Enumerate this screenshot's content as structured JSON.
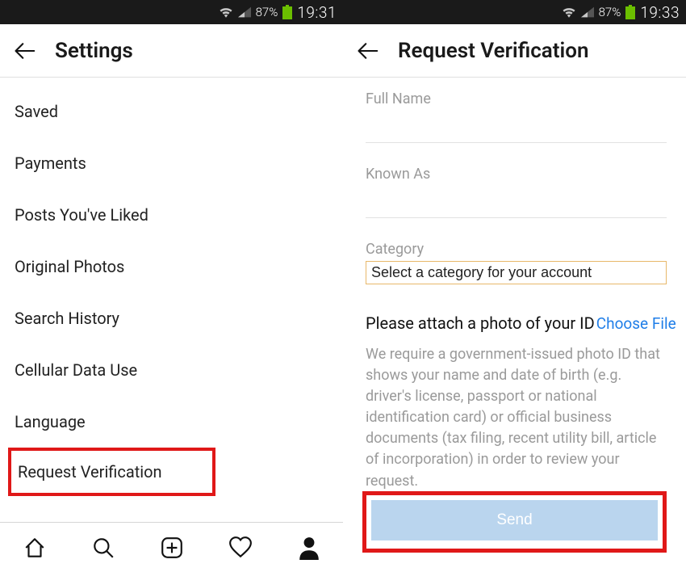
{
  "left": {
    "status": {
      "battery_pct": "87%",
      "time": "19:31"
    },
    "header": {
      "title": "Settings"
    },
    "items": [
      "Saved",
      "Payments",
      "Posts You've Liked",
      "Original Photos",
      "Search History",
      "Cellular Data Use",
      "Language",
      "Request Verification"
    ]
  },
  "right": {
    "status": {
      "battery_pct": "87%",
      "time": "19:33"
    },
    "header": {
      "title": "Request Verification"
    },
    "labels": {
      "full_name": "Full Name",
      "known_as": "Known As",
      "category": "Category"
    },
    "category_placeholder": "Select a category for your account",
    "attach_prompt": "Please attach a photo of your ID",
    "choose_file": "Choose File",
    "helper": "We require a government-issued photo ID that shows your name and date of birth (e.g. driver's license, passport or national identification card) or official business documents (tax filing, recent utility bill, article of incorporation) in order to review your request.",
    "send_label": "Send"
  }
}
